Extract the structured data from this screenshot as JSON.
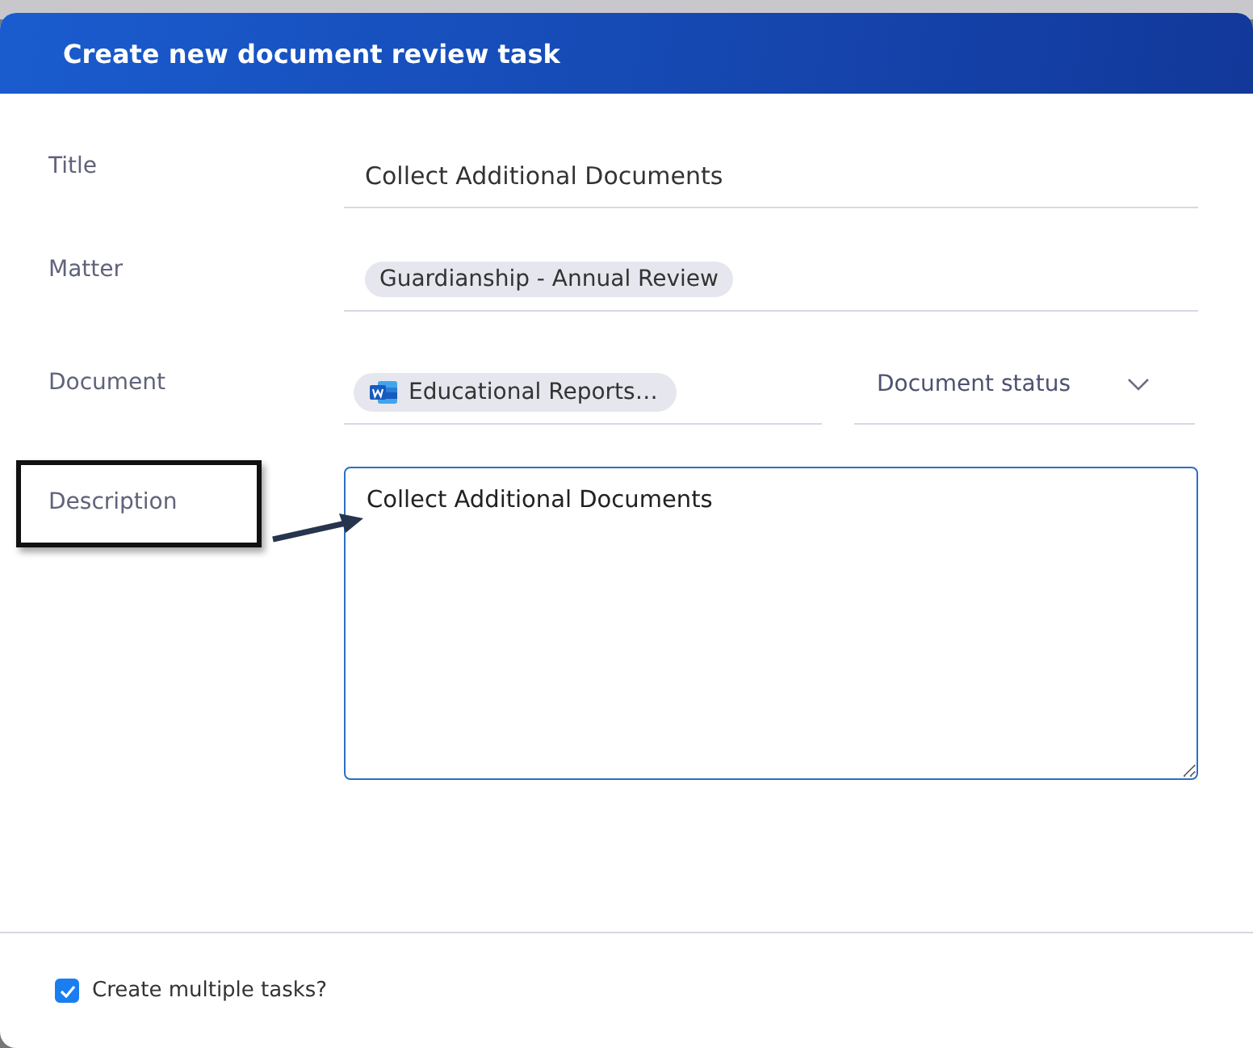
{
  "dialog": {
    "title": "Create new document review task"
  },
  "form": {
    "title": {
      "label": "Title",
      "value": "Collect Additional Documents"
    },
    "matter": {
      "label": "Matter",
      "chip": "Guardianship - Annual Review"
    },
    "document": {
      "label": "Document",
      "chip": "Educational Reports…",
      "status_placeholder": "Document status"
    },
    "description": {
      "label": "Description",
      "value": "Collect Additional Documents",
      "highlighted": true
    }
  },
  "footer": {
    "multiple_tasks": {
      "label": "Create multiple tasks?",
      "checked": true
    }
  }
}
